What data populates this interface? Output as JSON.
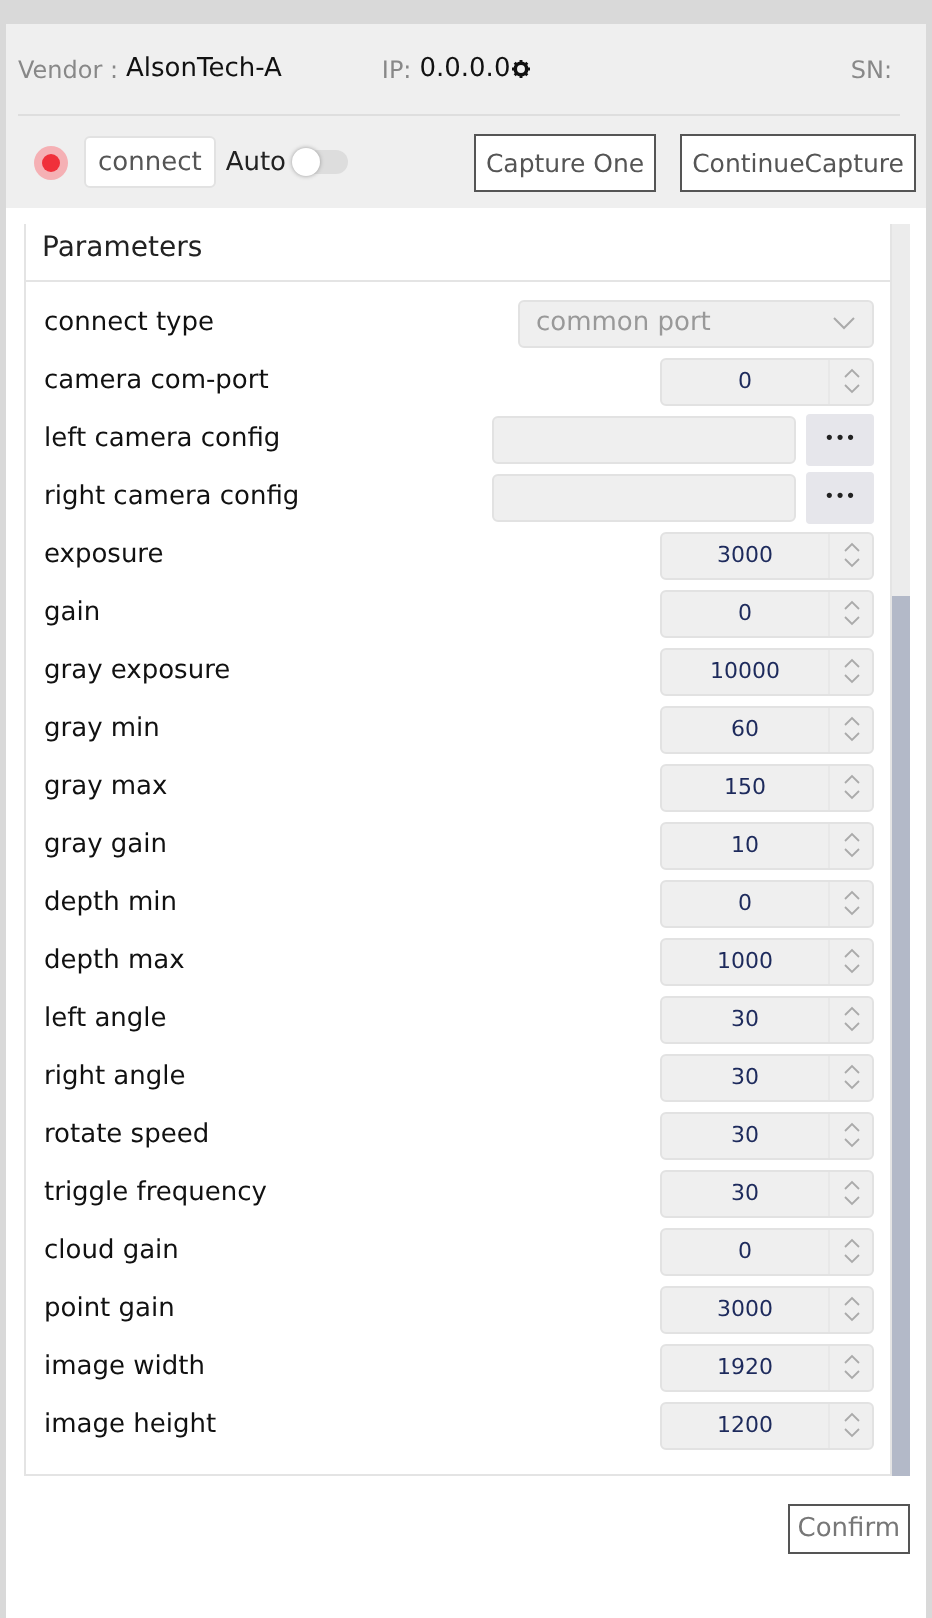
{
  "device": {
    "vendor_label": "Vendor :",
    "vendor": "AlsonTech-A",
    "ip_label": "IP:",
    "ip": "0.0.0.0",
    "sn_label": "SN:"
  },
  "toolbar": {
    "connected": false,
    "connect_label": "connect",
    "auto_label": "Auto",
    "auto_on": false,
    "buttons": [
      "Capture One",
      "ContinueCapture"
    ]
  },
  "parameters": {
    "title": "Parameters",
    "rows": [
      {
        "kind": "select",
        "label": "connect type",
        "value": "common port"
      },
      {
        "kind": "number",
        "label": "camera com-port",
        "value": "0"
      },
      {
        "kind": "file",
        "label": "left camera config",
        "button": "•••"
      },
      {
        "kind": "file",
        "label": "right camera config",
        "button": "•••"
      },
      {
        "kind": "number",
        "label": "exposure",
        "value": "3000"
      },
      {
        "kind": "number",
        "label": "gain",
        "value": "0"
      },
      {
        "kind": "number",
        "label": "gray exposure",
        "value": "10000"
      },
      {
        "kind": "number",
        "label": "gray min",
        "value": "60"
      },
      {
        "kind": "number",
        "label": "gray max",
        "value": "150"
      },
      {
        "kind": "number",
        "label": "gray gain",
        "value": "10"
      },
      {
        "kind": "number",
        "label": "depth min",
        "value": "0"
      },
      {
        "kind": "number",
        "label": "depth max",
        "value": "1000"
      },
      {
        "kind": "number",
        "label": "left angle",
        "value": "30"
      },
      {
        "kind": "number",
        "label": "right angle",
        "value": "30"
      },
      {
        "kind": "number",
        "label": "rotate speed",
        "value": "30"
      },
      {
        "kind": "number",
        "label": "triggle frequency",
        "value": "30"
      },
      {
        "kind": "number",
        "label": "cloud gain",
        "value": "0"
      },
      {
        "kind": "number",
        "label": "point gain",
        "value": "3000"
      },
      {
        "kind": "number",
        "label": "image width",
        "value": "1920"
      },
      {
        "kind": "number",
        "label": "image height",
        "value": "1200"
      }
    ]
  },
  "confirm": "Confirm"
}
